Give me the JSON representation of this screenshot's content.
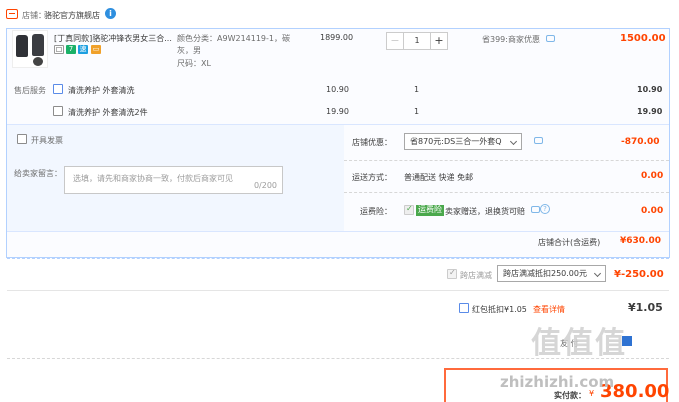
{
  "shop": {
    "label": "店铺：",
    "name": "骆驼官方旗舰店"
  },
  "product": {
    "title": "[丁真同款]骆驼冲锋衣男女三合...",
    "attr_label_color": "颜色分类：",
    "attr_color_value": "A9W214119-1，碳灰，男",
    "attr_size": "尺码：XL",
    "unit_price": "1899.00",
    "quantity": "1",
    "promo": "省399:商家优惠",
    "subtotal": "1500.00"
  },
  "after_sales": {
    "label": "售后服务",
    "options": [
      {
        "name": "清洗养护 外套清洗",
        "price": "10.90",
        "qty": "1",
        "total": "10.90"
      },
      {
        "name": "清洗养护 外套清洗2件",
        "price": "19.90",
        "qty": "1",
        "total": "19.90"
      }
    ]
  },
  "invoice_label": "开具发票",
  "memo": {
    "label": "给卖家留言：",
    "placeholder": "选填，请先和商家协商一致，付款后商家可见",
    "counter": "0/200"
  },
  "shop_discount": {
    "label": "店铺优惠：",
    "selected": "省870元:DS三合一外套Q",
    "amount": "-870.00"
  },
  "shipping": {
    "label": "运送方式：",
    "value": "普通配送 快递 免邮",
    "amount": "0.00"
  },
  "insurance": {
    "label": "运费险：",
    "tag": "运费险",
    "text": "卖家赠送，退换货可赔",
    "amount": "0.00"
  },
  "store_total": {
    "label": "店铺合计(含运费)",
    "amount": "¥630.00"
  },
  "cross_store": {
    "label": "跨店满减",
    "selected": "跨店满减抵扣250.00元",
    "amount": "¥-250.00"
  },
  "red_packet": {
    "label": "红包抵扣¥1.05",
    "link": "查看详情",
    "amount": "¥1.05"
  },
  "payment": {
    "partial": "友  付",
    "label": "实付款：",
    "currency": "¥",
    "amount": "380.00"
  },
  "watermark": {
    "big": "值值值",
    "small": "zhizhizhi.com"
  },
  "colors": {
    "accent": "#ff4400",
    "blue_border": "#b2d1ff",
    "tag_green": "#4aa84c"
  },
  "icons": [
    "shop-icon",
    "info-icon",
    "minus-icon",
    "plus-icon",
    "chat-icon",
    "help-icon",
    "checkbox-icon",
    "chevron-down-icon"
  ]
}
